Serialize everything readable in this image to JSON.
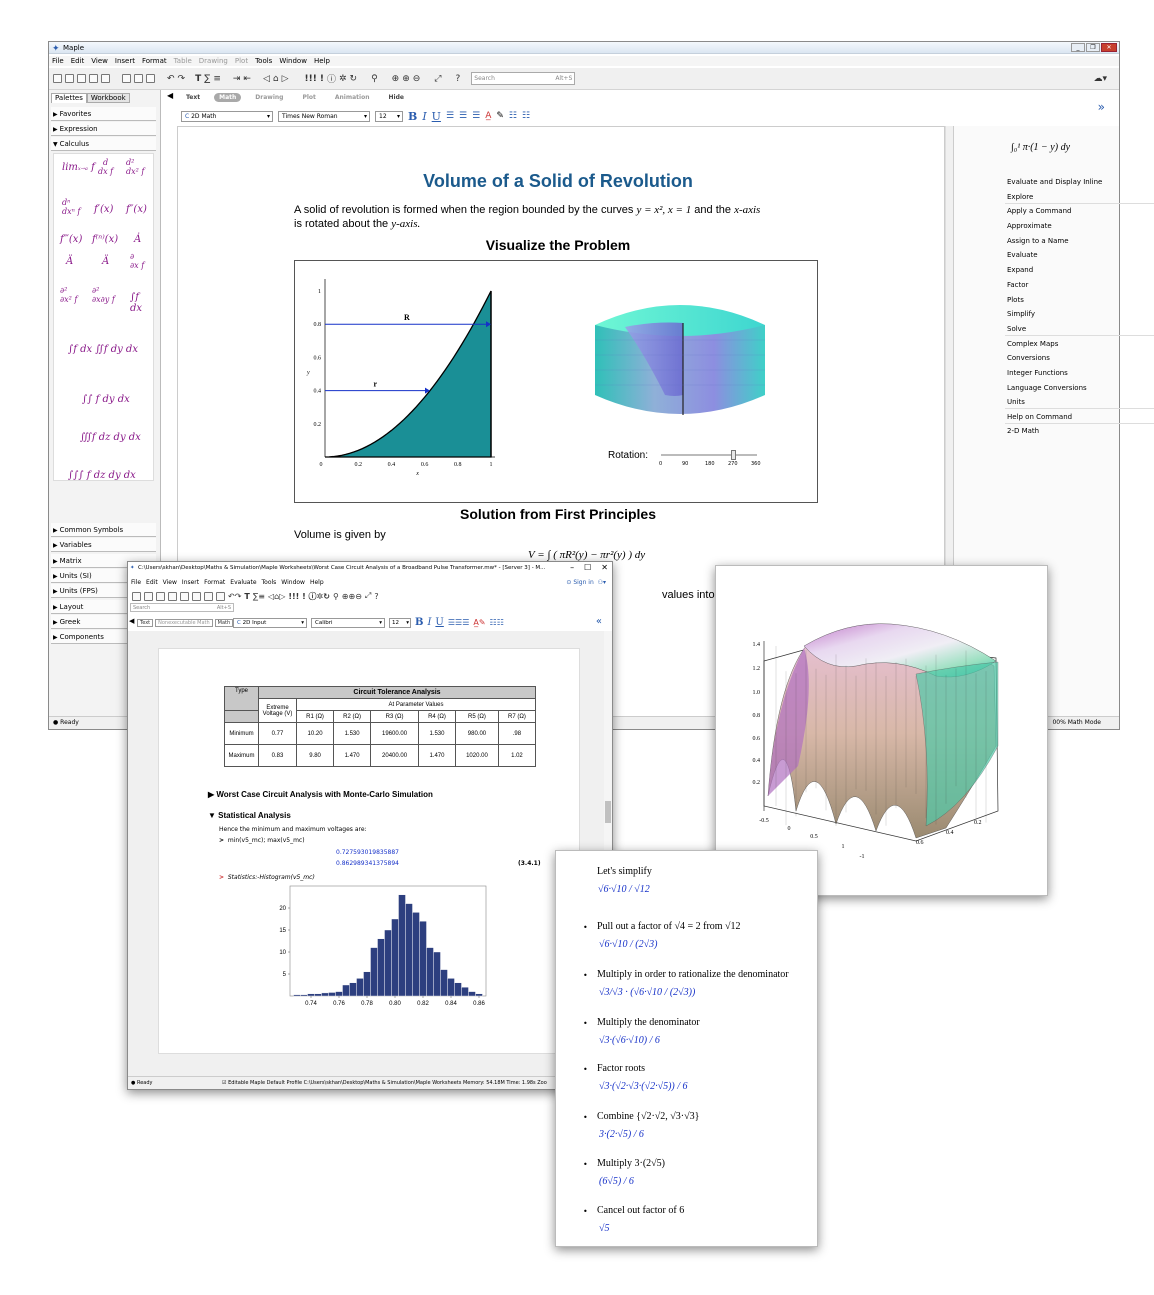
{
  "main": {
    "title": "Maple",
    "menus": [
      "File",
      "Edit",
      "View",
      "Insert",
      "Format",
      "Table",
      "Drawing",
      "Plot",
      "Tools",
      "Window",
      "Help"
    ],
    "search_placeholder": "Search",
    "search_shortcut": "Alt+S",
    "left_tabs": [
      "Palettes",
      "Workbook"
    ],
    "palettes_top": [
      "Favorites",
      "Expression",
      "Calculus"
    ],
    "palettes_bottom": [
      "Common Symbols",
      "Variables",
      "Matrix",
      "Units (SI)",
      "Units (FPS)",
      "Layout",
      "Greek",
      "Components"
    ],
    "mode_tabs": [
      "Text",
      "Math",
      "Drawing",
      "Plot",
      "Animation",
      "Hide"
    ],
    "style_select": "2D Math",
    "font_select": "Times New Roman",
    "size_select": "12",
    "doc_title": "Volume of a Solid of Revolution",
    "intro": "A solid of revolution is formed when the region bounded by the curves",
    "intro_math": "y = x², x = 1",
    "intro_tail": "and the",
    "intro_axis": "x-axis",
    "intro_line2a": "is rotated about the",
    "intro_line2b": "y-axis.",
    "h_visualize": "Visualize the Problem",
    "h_solution": "Solution from First Principles",
    "volume_text": "Volume is given by",
    "values_text": "values into the abov",
    "rotation_label": "Rotation:",
    "rotation_ticks": [
      "0",
      "90",
      "180",
      "270",
      "360"
    ],
    "plot_R": "R",
    "plot_r": "r",
    "plot_yticks": [
      "1",
      "0.8",
      "0.6",
      "0.4",
      "0.2"
    ],
    "plot_xticks": [
      "0",
      "0.2",
      "0.4",
      "0.6",
      "0.8",
      "1"
    ],
    "plot_xlabel": "x",
    "plot_ylabel": "y",
    "context_integral": "∫₀¹ π·(1 − y) dy",
    "context_items": [
      "Evaluate and Display Inline",
      "Explore",
      "Apply a Command",
      "Approximate",
      "Assign to a Name",
      "Evaluate",
      "Expand",
      "Factor",
      "Plots",
      "Simplify",
      "Solve",
      "Complex Maps",
      "Conversions",
      "Integer Functions",
      "Language Conversions",
      "Units",
      "Help on Command",
      "2-D Math"
    ],
    "status_ready": "Ready",
    "status_right": "00%   Math Mode"
  },
  "sub": {
    "title": "C:\\Users\\skhan\\Desktop\\Maths & Simulation\\Maple Worksheets\\Worst Case Circuit Analysis of a Broadband Pulse Transformer.mw* - [Server 3] - M...",
    "menus": [
      "File",
      "Edit",
      "View",
      "Insert",
      "Format",
      "Evaluate",
      "Tools",
      "Window",
      "Help"
    ],
    "sign_in": "Sign in",
    "search_placeholder": "Search",
    "search_shortcut": "Alt+S",
    "mode_tabs": [
      "Text",
      "Nonexecutable Math",
      "Math"
    ],
    "style_select": "2D Input",
    "font_select": "Calibri",
    "size_select": "12",
    "table": {
      "title": "Circuit Tolerance Analysis",
      "type_header": "Type",
      "extreme_header": "Extreme Voltage (V)",
      "param_header": "At Parameter Values",
      "cols": [
        "R1 (Ω)",
        "R2 (Ω)",
        "R3 (Ω)",
        "R4 (Ω)",
        "R5 (Ω)",
        "R7 (Ω)"
      ],
      "rows": [
        {
          "type": "Minimum",
          "v": "0.77",
          "vals": [
            "10.20",
            "1.530",
            "19600.00",
            "1.530",
            "980.00",
            ".98"
          ]
        },
        {
          "type": "Maximum",
          "v": "0.83",
          "vals": [
            "9.80",
            "1.470",
            "20400.00",
            "1.470",
            "1020.00",
            "1.02"
          ]
        }
      ]
    },
    "sec1": "Worst Case Circuit Analysis with Monte-Carlo Simulation",
    "sec2": "Statistical Analysis",
    "hence": "Hence the minimum and maximum voltages are:",
    "cmd1": "min(v5_mc); max(v5_mc)",
    "out1": "0.727593019835887",
    "out2": "0.862989341375894",
    "eq_label": "(3.4.1)",
    "cmd2": "Statistics:-Histogram(v5_mc)",
    "status_ready": "Ready",
    "status_text": "Editable    Maple Default Profile    C:\\Users\\skhan\\Desktop\\Maths & Simulation\\Maple Worksheets    Memory: 54.18M    Time: 1.98s   Zoo"
  },
  "chart_data": [
    {
      "type": "bar",
      "title": "",
      "xlabel": "",
      "ylabel": "",
      "categories": [
        0.73,
        0.735,
        0.74,
        0.745,
        0.75,
        0.755,
        0.76,
        0.765,
        0.77,
        0.775,
        0.78,
        0.785,
        0.79,
        0.795,
        0.8,
        0.805,
        0.81,
        0.815,
        0.82,
        0.825,
        0.83,
        0.835,
        0.84,
        0.845,
        0.85,
        0.855,
        0.86
      ],
      "values": [
        0.3,
        0.3,
        0.5,
        0.5,
        0.7,
        0.8,
        1,
        2.5,
        3,
        4,
        5.5,
        11,
        13,
        15,
        17.5,
        23,
        21,
        19,
        17,
        11,
        10,
        6,
        4,
        3,
        2,
        1,
        0.5
      ],
      "xticks": [
        "0.74",
        "0.76",
        "0.78",
        "0.80",
        "0.82",
        "0.84",
        "0.86"
      ],
      "yticks": [
        "5",
        "10",
        "15",
        "20"
      ],
      "xlim": [
        0.725,
        0.865
      ],
      "ylim": [
        0,
        25
      ],
      "color": "#2d3f7f"
    },
    {
      "type": "area",
      "title": "",
      "xlabel": "x",
      "ylabel": "y",
      "function": "y = x^2",
      "x": [
        0,
        0.1,
        0.2,
        0.3,
        0.4,
        0.5,
        0.6,
        0.7,
        0.8,
        0.9,
        1
      ],
      "y": [
        0,
        0.01,
        0.04,
        0.09,
        0.16,
        0.25,
        0.36,
        0.49,
        0.64,
        0.81,
        1
      ],
      "xlim": [
        0,
        1
      ],
      "ylim": [
        0,
        1
      ],
      "fill": "#1a8f96"
    },
    {
      "type": "surface",
      "zticks": [
        "1.4",
        "1.2",
        "1.0",
        "0.8",
        "0.6",
        "0.4",
        "0.2"
      ],
      "xticks": [
        "-0.5",
        "0",
        "0.5",
        "1",
        "-1"
      ],
      "yticks": [
        "0.6",
        "0.4",
        "0.2"
      ]
    }
  ],
  "steps": {
    "intro": "Let's simplify",
    "items": [
      {
        "text": "Pull out a factor of √4 = 2 from √12",
        "math": "√6·√10 / (2√3)"
      },
      {
        "text": "Multiply in order to rationalize the denominator",
        "math": "√3/√3 · (√6·√10 / (2√3))"
      },
      {
        "text": "Multiply the denominator",
        "math": "√3·(√6·√10) / 6"
      },
      {
        "text": "Factor roots",
        "math": "√3·(√2·√3·(√2·√5)) / 6"
      },
      {
        "text": "Combine {√2·√2, √3·√3}",
        "math": "3·(2·√5) / 6"
      },
      {
        "text": "Multiply 3·(2√5)",
        "math": "(6√5) / 6"
      },
      {
        "text": "Cancel out factor of 6",
        "math": "√5"
      }
    ],
    "first_math": "√6·√10 / √12"
  }
}
